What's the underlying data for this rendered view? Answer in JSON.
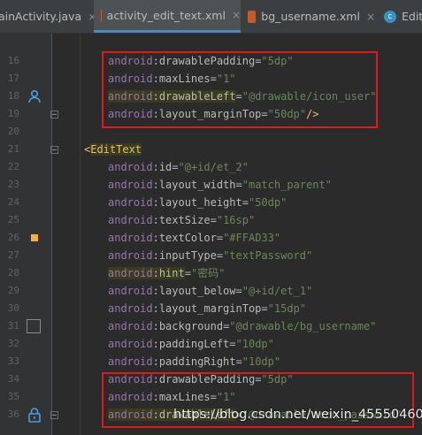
{
  "tabs": [
    {
      "label": "ainActivity.java",
      "active": false,
      "icon": "java-file-icon",
      "close": "×"
    },
    {
      "label": "activity_edit_text.xml",
      "active": true,
      "icon": "xml-file-icon",
      "close": "×"
    },
    {
      "label": "bg_username.xml",
      "active": false,
      "icon": "xml-file-icon",
      "close": "×"
    },
    {
      "label": "EditT",
      "active": false,
      "icon": "class-icon",
      "close": ""
    }
  ],
  "code_lines": [
    {
      "n": "16",
      "attr": "drawablePadding",
      "value": "\"5dp\""
    },
    {
      "n": "17",
      "attr": "maxLines",
      "value": "\"1\""
    },
    {
      "n": "18",
      "attr": "drawableLeft",
      "value": "\"@drawable/icon_user\"",
      "highlight": true
    },
    {
      "n": "19",
      "attr": "layout_marginTop",
      "value": "\"50dp\"",
      "suffix": "/>"
    },
    {
      "n": "20"
    },
    {
      "n": "21",
      "tag": "EditText"
    },
    {
      "n": "22",
      "attr": "id",
      "value": "\"@+id/et_2\""
    },
    {
      "n": "23",
      "attr": "layout_width",
      "value": "\"match_parent\""
    },
    {
      "n": "24",
      "attr": "layout_height",
      "value": "\"50dp\""
    },
    {
      "n": "25",
      "attr": "textSize",
      "value": "\"16sp\""
    },
    {
      "n": "26",
      "attr": "textColor",
      "value": "\"#FFAD33\""
    },
    {
      "n": "27",
      "attr": "inputType",
      "value": "\"textPassword\""
    },
    {
      "n": "28",
      "attr": "hint",
      "value": "\"密码\"",
      "highlight": true
    },
    {
      "n": "29",
      "attr": "layout_below",
      "value": "\"@+id/et_1\""
    },
    {
      "n": "30",
      "attr": "layout_marginTop",
      "value": "\"15dp\""
    },
    {
      "n": "31",
      "attr": "background",
      "value": "\"@drawable/bg_username\""
    },
    {
      "n": "32",
      "attr": "paddingLeft",
      "value": "\"10dp\""
    },
    {
      "n": "33",
      "attr": "paddingRight",
      "value": "\"10dp\""
    },
    {
      "n": "34",
      "attr": "drawablePadding",
      "value": "\"5dp\""
    },
    {
      "n": "35",
      "attr": "maxLines",
      "value": "\"1\""
    },
    {
      "n": "36",
      "attr": "drawableLeft",
      "value": "\"@drawable/icon_password\"",
      "highlight": true
    }
  ],
  "namespace": "android",
  "colors": {
    "swatch": "#FFAD33",
    "highlight_box": "#E0191B"
  },
  "watermark": "https://blog.csdn.net/weixin_45550460"
}
